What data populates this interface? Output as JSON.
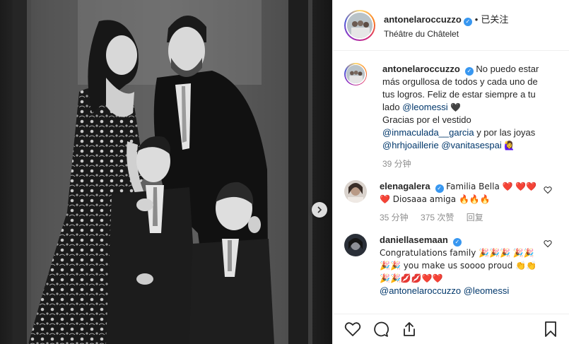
{
  "header": {
    "username": "antonelaroccuzzo",
    "separator": "•",
    "follow_label": "已关注",
    "location": "Théâtre du Châtelet"
  },
  "caption": {
    "username": "antonelaroccuzzo",
    "text_1": "No puedo estar más orgullosa de todos y cada uno de tus logros. Feliz de estar siempre a tu lado",
    "mention_1": "@leomessi",
    "emoji_1": "🖤",
    "text_2": "Gracias por el vestido",
    "mention_2": "@inmaculada__garcia",
    "text_3": "y por las joyas",
    "mention_3": "@hrhjoaillerie",
    "mention_4": "@vanitasespai",
    "emoji_2": "🙋‍♀️",
    "time": "39 分钟"
  },
  "comments": [
    {
      "username": "elenagalera",
      "text": "Familia Bella ❤️ ❤️❤️❤️ Diosaaa amiga 🔥🔥🔥",
      "time": "35 分钟",
      "likes": "375 次赞",
      "reply_label": "回复"
    },
    {
      "username": "daniellasemaan",
      "text_1": "Congratulations family 🎉🎉🎉 🎉🎉🎉🎉 you make us soooo proud 👏👏🎉🎉💋💋❤️❤️",
      "mention_1": "@antonelaroccuzzo",
      "mention_2": "@leomessi"
    }
  ],
  "icons": {
    "like": "heart-icon",
    "comment": "comment-icon",
    "share": "share-icon",
    "save": "bookmark-icon",
    "next": "chevron-right-icon"
  },
  "colors": {
    "verified": "#3897f0",
    "mention": "#00376b",
    "muted": "#8e8e8e"
  }
}
